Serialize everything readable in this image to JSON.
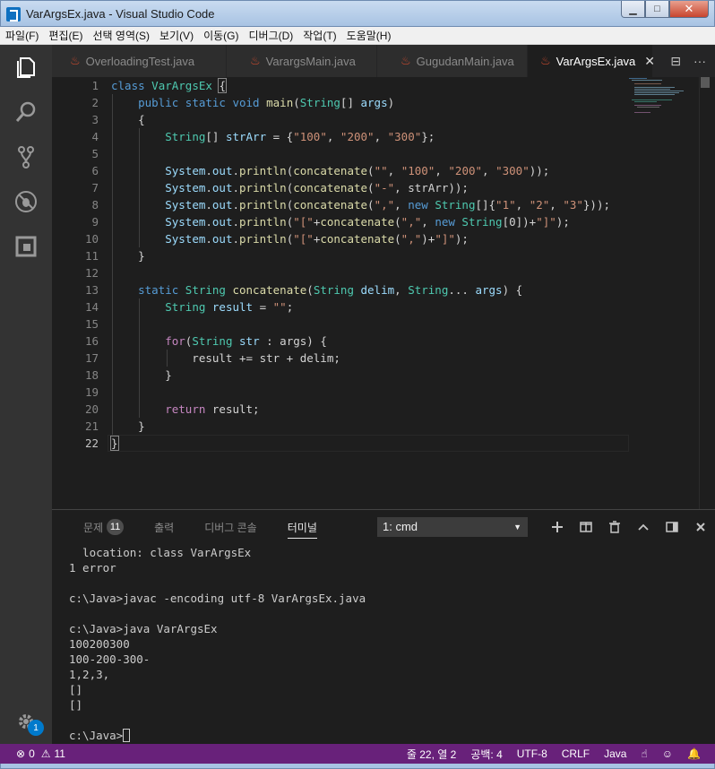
{
  "window": {
    "title": "VarArgsEx.java - Visual Studio Code",
    "minimize": "▁",
    "maximize": "□",
    "close": "✕"
  },
  "menu": [
    "파일(F)",
    "편집(E)",
    "선택 영역(S)",
    "보기(V)",
    "이동(G)",
    "디버그(D)",
    "작업(T)",
    "도움말(H)"
  ],
  "activity": {
    "icons": [
      "files-icon",
      "search-icon",
      "source-control-icon",
      "debug-icon",
      "extensions-icon",
      "settings-gear-icon"
    ],
    "settings_badge": "1"
  },
  "tabs": [
    {
      "label": "OverloadingTest.java",
      "active": false
    },
    {
      "label": "VarargsMain.java",
      "active": false
    },
    {
      "label": "GugudanMain.java",
      "active": false
    },
    {
      "label": "VarArgsEx.java",
      "active": true
    }
  ],
  "tab_close": "✕",
  "tab_actions": {
    "split": "⊟",
    "more": "···"
  },
  "editor": {
    "line_numbers": [
      "1",
      "2",
      "3",
      "4",
      "5",
      "6",
      "7",
      "8",
      "9",
      "10",
      "11",
      "12",
      "13",
      "14",
      "15",
      "16",
      "17",
      "18",
      "19",
      "20",
      "21",
      "22"
    ],
    "current_line": 22
  },
  "panel": {
    "tabs": [
      {
        "label": "문제",
        "count": "11"
      },
      {
        "label": "출력"
      },
      {
        "label": "디버그 콘솔"
      },
      {
        "label": "터미널",
        "active": true
      }
    ],
    "terminal_select": "1: cmd",
    "terminal_lines": [
      "  location: class VarArgsEx",
      "1 error",
      "",
      "c:\\Java>javac -encoding utf-8 VarArgsEx.java",
      "",
      "c:\\Java>java VarArgsEx",
      "100200300",
      "100-200-300-",
      "1,2,3,",
      "[]",
      "[]",
      ""
    ],
    "prompt": "c:\\Java>"
  },
  "status": {
    "errors": "0",
    "warnings": "11",
    "position": "줄 22, 열 2",
    "spaces": "공백: 4",
    "encoding": "UTF-8",
    "eol": "CRLF",
    "language": "Java"
  },
  "colors": {
    "statusbar": "#68217a",
    "activitybar": "#333333",
    "editor_bg": "#1e1e1e",
    "keyword": "#569cd6",
    "type": "#4ec9b0",
    "string": "#ce9178"
  }
}
